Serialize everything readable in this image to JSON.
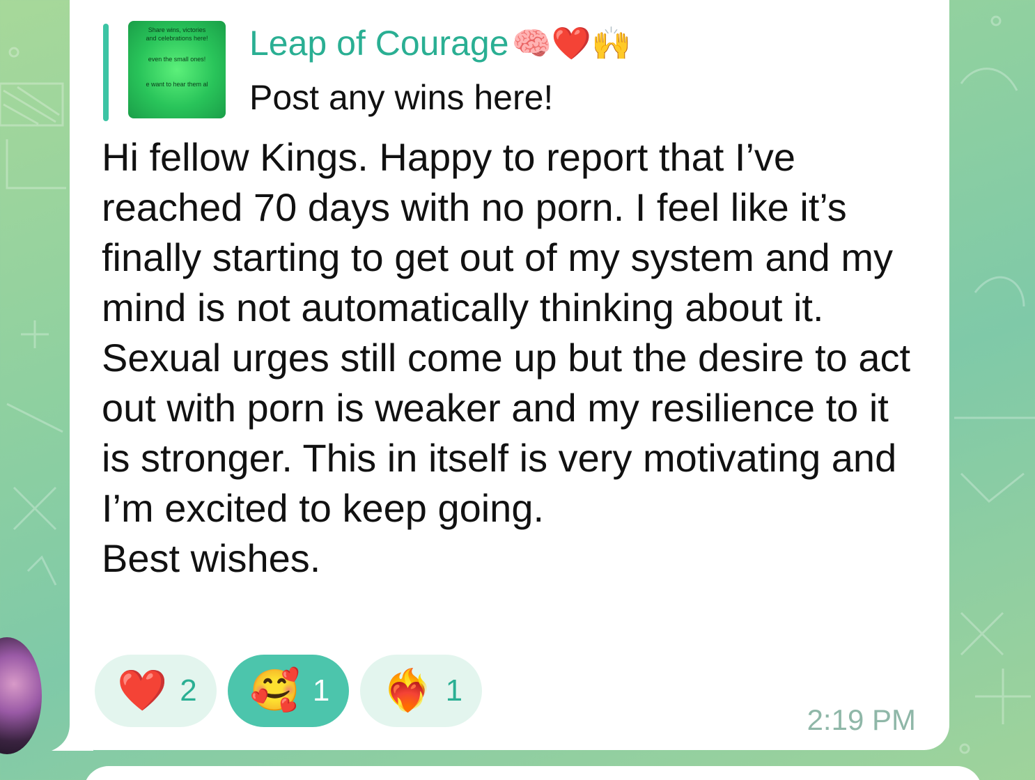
{
  "reply": {
    "thumb_lines": [
      "Share wins, victories",
      "and celebrations here!",
      "even the small ones!",
      "e want to hear them al"
    ],
    "title": "Leap of Courage",
    "title_emojis": "🧠❤️🙌",
    "subtitle": "Post any wins here!"
  },
  "message": {
    "text": "Hi fellow Kings. Happy to report that I’ve reached 70 days with no porn. I feel like it’s finally starting to get out of my system and my mind is not automatically thinking about it. Sexual urges still come up but the desire to act out with porn is weaker and my resilience to it is stronger. This in itself is very motivating and I’m excited to keep going.\nBest wishes."
  },
  "reactions": [
    {
      "emoji": "❤️",
      "count": "2",
      "active": false
    },
    {
      "emoji": "🥰",
      "count": "1",
      "active": true
    },
    {
      "emoji": "❤️‍🔥",
      "count": "1",
      "active": false
    }
  ],
  "time": "2:19 PM",
  "colors": {
    "accent": "#2aaf93",
    "reaction_bg": "#e3f5ee",
    "reaction_active_bg": "#4cc5ac"
  }
}
